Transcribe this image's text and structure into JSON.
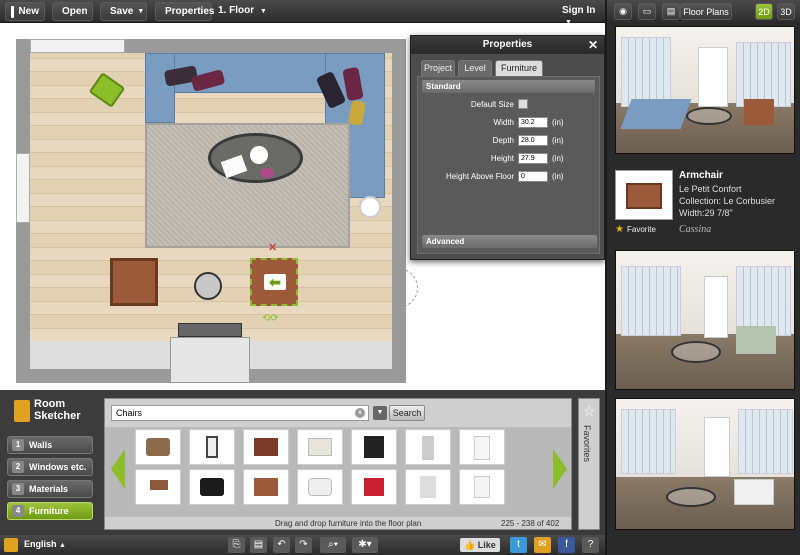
{
  "toolbar": {
    "new_label": "New",
    "open_label": "Open",
    "save_label": "Save",
    "properties_label": "Properties",
    "floor_label": "1. Floor",
    "signin_label": "Sign In"
  },
  "right_toolbar": {
    "floor_plans_label": "Floor Plans",
    "view_2d": "2D",
    "view_3d": "3D"
  },
  "properties": {
    "title": "Properties",
    "tabs": [
      "Project",
      "Level",
      "Furniture"
    ],
    "active_tab": "Furniture",
    "section_standard": "Standard",
    "section_advanced": "Advanced",
    "fields": [
      {
        "label": "Default Size",
        "type": "checkbox",
        "value": ""
      },
      {
        "label": "Width",
        "value": "30.2",
        "unit": "(in)"
      },
      {
        "label": "Depth",
        "value": "28.0",
        "unit": "(in)"
      },
      {
        "label": "Height",
        "value": "27.9",
        "unit": "(in)"
      },
      {
        "label": "Height Above Floor",
        "value": "0",
        "unit": "(in)"
      }
    ]
  },
  "product": {
    "name": "Armchair",
    "line1": "Le Petit Confort",
    "line2": "Collection: Le Corbusier",
    "line3": "Width:29 7/8\"",
    "favorite_label": "Favorite",
    "brand": "Cassina"
  },
  "logo": {
    "line1": "Room",
    "line2": "Sketcher"
  },
  "nav": {
    "items": [
      {
        "num": "1",
        "label": "Walls"
      },
      {
        "num": "2",
        "label": "Windows etc."
      },
      {
        "num": "3",
        "label": "Materials"
      },
      {
        "num": "4",
        "label": "Furniture"
      }
    ]
  },
  "catalog": {
    "search_value": "Chairs",
    "search_button": "Search",
    "hint": "Drag and drop furniture into the floor plan",
    "count": "225 - 238 of 402",
    "favorites_label": "Favorites"
  },
  "status": {
    "language": "English",
    "like_label": "Like"
  },
  "colors": {
    "accent_green": "#8cbd2a",
    "sofa_blue": "#7a9cc0",
    "twitter_blue": "#3a9ad9",
    "facebook_blue": "#3b5998"
  }
}
